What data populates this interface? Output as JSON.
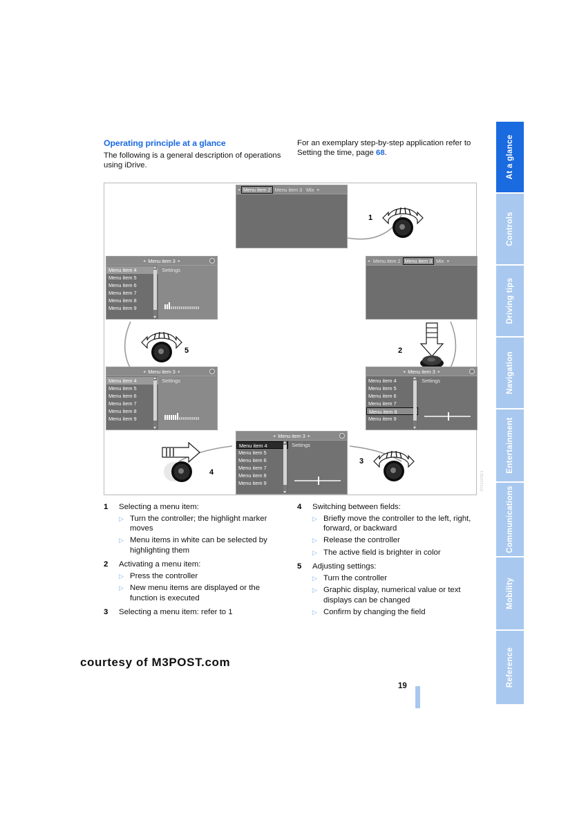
{
  "header": {
    "section_title": "Operating principle at a glance",
    "intro": "The following is a general description of operations using iDrive.",
    "cross_ref_pre": "For an exemplary step-by-step application refer to Setting the time, page ",
    "cross_ref_page": "68",
    "cross_ref_post": "."
  },
  "tabs": [
    {
      "label": "At a glance",
      "active": true
    },
    {
      "label": "Controls",
      "active": false
    },
    {
      "label": "Driving tips",
      "active": false
    },
    {
      "label": "Navigation",
      "active": false
    },
    {
      "label": "Entertainment",
      "active": false
    },
    {
      "label": "Communications",
      "active": false
    },
    {
      "label": "Mobility",
      "active": false
    },
    {
      "label": "Reference",
      "active": false
    }
  ],
  "figure": {
    "code": "ST0104SE1",
    "screens": {
      "top": {
        "tab_items": [
          "Menu item 2",
          "Menu item 3",
          "Mix"
        ],
        "selected_tab": "Menu item 2"
      },
      "right_upper": {
        "tab_items": [
          "Menu item 2",
          "Menu item 3",
          "Mix"
        ],
        "selected_tab": "Menu item 3"
      },
      "right_lower": {
        "title": "Menu item 3",
        "list": [
          "Menu item 4",
          "Menu item 5",
          "Menu item 6",
          "Menu item 7",
          "Menu item 8",
          "Menu item 9"
        ],
        "selected_item": "Menu item 8",
        "settings_label": "Settings",
        "control": "slider",
        "slider_percent": 50
      },
      "bottom": {
        "title": "Menu item 3",
        "list": [
          "Menu item 4",
          "Menu item 5",
          "Menu item 6",
          "Menu item 7",
          "Menu item 8",
          "Menu item 9"
        ],
        "selected_item": "Menu item 4",
        "settings_label": "Settings",
        "control": "slider",
        "slider_percent": 50
      },
      "left_lower": {
        "title": "Menu item 3",
        "list": [
          "Menu item 4",
          "Menu item 5",
          "Menu item 6",
          "Menu item 7",
          "Menu item 8",
          "Menu item 9"
        ],
        "selected_item": "Menu item 4",
        "settings_label": "Settings",
        "control": "meter",
        "meter_filled": 6,
        "meter_total": 16
      },
      "left_upper": {
        "title": "Menu item 3",
        "list": [
          "Menu item 4",
          "Menu item 5",
          "Menu item 6",
          "Menu item 7",
          "Menu item 8",
          "Menu item 9"
        ],
        "selected_item": "Menu item 4",
        "settings_label": "Settings",
        "control": "meter",
        "meter_filled": 2,
        "meter_total": 16
      }
    },
    "step_markers": [
      {
        "number": "1",
        "icon": "controller-rotate-icon"
      },
      {
        "number": "2",
        "icon": "controller-press-icon"
      },
      {
        "number": "3",
        "icon": "controller-rotate-icon"
      },
      {
        "number": "4",
        "icon": "controller-shift-right-icon"
      },
      {
        "number": "5",
        "icon": "controller-rotate-icon"
      }
    ]
  },
  "captions": {
    "left": [
      {
        "number": "1",
        "heading": "Selecting a menu item:",
        "bullets": [
          "Turn the controller; the highlight marker moves",
          "Menu items in white can be selected by highlighting them"
        ]
      },
      {
        "number": "2",
        "heading": "Activating a menu item:",
        "bullets": [
          "Press the controller",
          "New menu items are displayed or the function is executed"
        ]
      },
      {
        "number": "3",
        "heading": "Selecting a menu item: refer to 1",
        "bullets": []
      }
    ],
    "right": [
      {
        "number": "4",
        "heading": "Switching between fields:",
        "bullets": [
          "Briefly move the controller to the left, right, forward, or backward",
          "Release the controller",
          "The active field is brighter in color"
        ]
      },
      {
        "number": "5",
        "heading": "Adjusting settings:",
        "bullets": [
          "Turn the controller",
          "Graphic display, numerical value or text displays can be changed",
          "Confirm by changing the field"
        ]
      }
    ]
  },
  "footer": {
    "watermark": "courtesy of M3POST.com",
    "page_number": "19"
  },
  "colors": {
    "accent_blue": "#1a6ae0",
    "tab_blue": "#a8c8ef",
    "bullet_blue": "#7fb2e8"
  }
}
